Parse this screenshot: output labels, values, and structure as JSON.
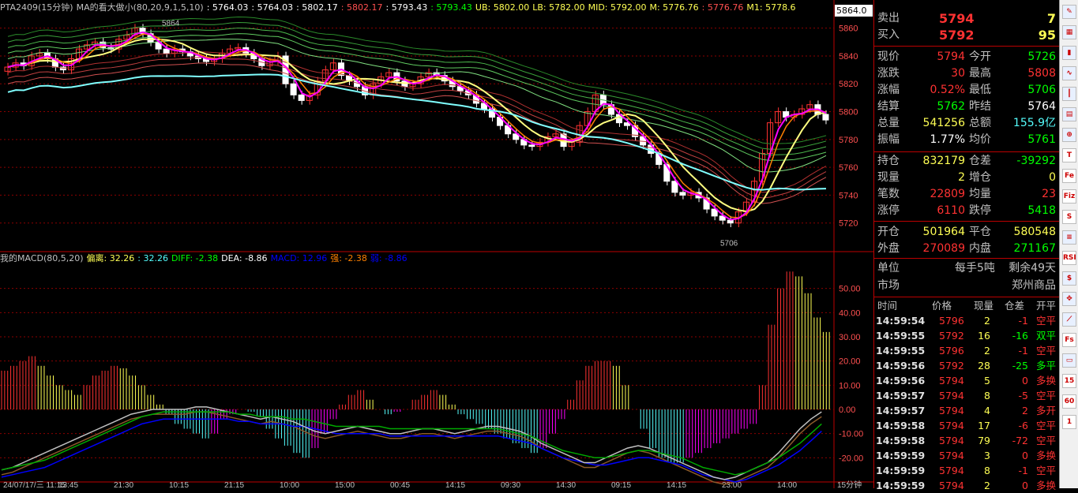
{
  "colors": {
    "up": "#ff3232",
    "down": "#54fcfc",
    "white": "#ffffff",
    "yellow": "#ffff54",
    "green": "#00ff00",
    "magenta": "#ff00ff",
    "orange": "#ff8000",
    "grid": "#8b0000"
  },
  "header": {
    "main": [
      {
        "text": "PTA2409(15分钟)",
        "color": "#c0c0c0"
      },
      {
        "text": "MA的看大做小(80,20,9,1,5,10)",
        "color": "#c0c0c0"
      },
      {
        "text": ": 5764.03",
        "color": "#ffffff"
      },
      {
        "text": ": 5764.03",
        "color": "#ffffff"
      },
      {
        "text": ": 5802.17",
        "color": "#ffffff"
      },
      {
        "text": ": 5802.17",
        "color": "#ff5050"
      },
      {
        "text": ": 5793.43",
        "color": "#ffffff"
      },
      {
        "text": ": 5793.43",
        "color": "#00ff00"
      },
      {
        "text": "UB: 5802.00",
        "color": "#ffff54"
      },
      {
        "text": "LB: 5782.00",
        "color": "#ffff54"
      },
      {
        "text": "MID: 5792.00",
        "color": "#ffff54"
      },
      {
        "text": "M: 5776.76",
        "color": "#ffff54"
      },
      {
        "text": ": 5776.76",
        "color": "#ff5050"
      },
      {
        "text": "M1: 5778.6",
        "color": "#ffff54"
      }
    ],
    "macd": [
      {
        "text": "我的MACD(80,5,20)",
        "color": "#c0c0c0"
      },
      {
        "text": "偏离: 32.26",
        "color": "#ffff54"
      },
      {
        "text": ": 32.26",
        "color": "#54fcfc"
      },
      {
        "text": "DIFF: -2.38",
        "color": "#00ff00"
      },
      {
        "text": "DEA: -8.86",
        "color": "#ffffff"
      },
      {
        "text": "MACD: 12.96",
        "color": "#0000ff"
      },
      {
        "text": "强: -2.38",
        "color": "#ff8000"
      },
      {
        "text": "弱: -8.86",
        "color": "#0000ff"
      }
    ]
  },
  "price_axis": {
    "labels": [
      "5860",
      "5840",
      "5820",
      "5800",
      "5780",
      "5760",
      "5740",
      "5720"
    ],
    "current": "5864.0"
  },
  "macd_axis": {
    "labels": [
      "50.00",
      "40.00",
      "30.00",
      "20.00",
      "10.00",
      "0.00",
      "-10.00",
      "-20.00"
    ]
  },
  "chart_labels": {
    "high_mark": "5864",
    "low_mark": "5706"
  },
  "time_axis": {
    "labels": [
      "24/07/17/三 11:15",
      "13:45",
      "21:30",
      "10:15",
      "21:15",
      "10:00",
      "15:00",
      "00:45",
      "14:15",
      "09:30",
      "14:30",
      "09:15",
      "14:15",
      "23:00",
      "14:00"
    ],
    "period": "15分钟"
  },
  "quote": {
    "ask": {
      "label": "卖出",
      "price": "5794",
      "vol": "7"
    },
    "bid": {
      "label": "买入",
      "price": "5792",
      "vol": "95"
    },
    "rows": [
      {
        "l1": "现价",
        "v1": "5794",
        "c1": "#ff3232",
        "l2": "今开",
        "v2": "5726",
        "c2": "#00ff00"
      },
      {
        "l1": "涨跌",
        "v1": "30",
        "c1": "#ff3232",
        "l2": "最高",
        "v2": "5808",
        "c2": "#ff3232"
      },
      {
        "l1": "涨幅",
        "v1": "0.52%",
        "c1": "#ff3232",
        "l2": "最低",
        "v2": "5706",
        "c2": "#00ff00"
      },
      {
        "l1": "结算",
        "v1": "5762",
        "c1": "#00ff00",
        "l2": "昨结",
        "v2": "5764",
        "c2": "#ffffff"
      },
      {
        "l1": "总量",
        "v1": "541256",
        "c1": "#ffff54",
        "l2": "总额",
        "v2": "155.9亿",
        "c2": "#54fcfc"
      },
      {
        "l1": "振幅",
        "v1": "1.77%",
        "c1": "#ffffff",
        "l2": "均价",
        "v2": "5761",
        "c2": "#00ff00"
      }
    ],
    "rows2": [
      {
        "l1": "持仓",
        "v1": "832179",
        "c1": "#ffff54",
        "l2": "仓差",
        "v2": "-39292",
        "c2": "#00ff00"
      },
      {
        "l1": "现量",
        "v1": "2",
        "c1": "#ffff54",
        "l2": "增仓",
        "v2": "0",
        "c2": "#ffff54"
      },
      {
        "l1": "笔数",
        "v1": "22809",
        "c1": "#ff3232",
        "l2": "均量",
        "v2": "23",
        "c2": "#ff3232"
      },
      {
        "l1": "涨停",
        "v1": "6110",
        "c1": "#ff3232",
        "l2": "跌停",
        "v2": "5418",
        "c2": "#00ff00"
      }
    ],
    "rows3": [
      {
        "l1": "开仓",
        "v1": "501964",
        "c1": "#ffff54",
        "l2": "平仓",
        "v2": "580548",
        "c2": "#ffff54"
      },
      {
        "l1": "外盘",
        "v1": "270089",
        "c1": "#ff3232",
        "l2": "内盘",
        "v2": "271167",
        "c2": "#00ff00"
      }
    ],
    "unit": {
      "label": "单位",
      "value": "每手5吨",
      "extra": "剩余49天"
    },
    "market": {
      "label": "市场",
      "value": "郑州商品"
    }
  },
  "ticks": {
    "headers": [
      "时间",
      "价格",
      "现量",
      "仓差",
      "开平"
    ],
    "rows": [
      {
        "t": "14:59:54",
        "p": "5796",
        "v": "2",
        "d": "-1",
        "k": "空平",
        "pc": "#ff3232",
        "dc": "#ff3232",
        "kc": "#ff3232"
      },
      {
        "t": "14:59:55",
        "p": "5792",
        "v": "16",
        "d": "-16",
        "k": "双平",
        "pc": "#ff3232",
        "dc": "#00ff00",
        "kc": "#00ff00"
      },
      {
        "t": "14:59:55",
        "p": "5796",
        "v": "2",
        "d": "-1",
        "k": "空平",
        "pc": "#ff3232",
        "dc": "#ff3232",
        "kc": "#ff3232"
      },
      {
        "t": "14:59:56",
        "p": "5792",
        "v": "28",
        "d": "-25",
        "k": "多平",
        "pc": "#ff3232",
        "dc": "#00ff00",
        "kc": "#00ff00"
      },
      {
        "t": "14:59:56",
        "p": "5794",
        "v": "5",
        "d": "0",
        "k": "多换",
        "pc": "#ff3232",
        "dc": "#ff3232",
        "kc": "#ff3232"
      },
      {
        "t": "14:59:57",
        "p": "5794",
        "v": "8",
        "d": "-5",
        "k": "空平",
        "pc": "#ff3232",
        "dc": "#ff3232",
        "kc": "#ff3232"
      },
      {
        "t": "14:59:57",
        "p": "5794",
        "v": "4",
        "d": "2",
        "k": "多开",
        "pc": "#ff3232",
        "dc": "#ff3232",
        "kc": "#ff3232"
      },
      {
        "t": "14:59:58",
        "p": "5794",
        "v": "17",
        "d": "-6",
        "k": "空平",
        "pc": "#ff3232",
        "dc": "#ff3232",
        "kc": "#ff3232"
      },
      {
        "t": "14:59:58",
        "p": "5794",
        "v": "79",
        "d": "-72",
        "k": "空平",
        "pc": "#ff3232",
        "dc": "#ff3232",
        "kc": "#ff3232"
      },
      {
        "t": "14:59:59",
        "p": "5794",
        "v": "3",
        "d": "0",
        "k": "多换",
        "pc": "#ff3232",
        "dc": "#ff3232",
        "kc": "#ff3232"
      },
      {
        "t": "14:59:59",
        "p": "5794",
        "v": "8",
        "d": "-1",
        "k": "空平",
        "pc": "#ff3232",
        "dc": "#ff3232",
        "kc": "#ff3232"
      },
      {
        "t": "14:59:59",
        "p": "5794",
        "v": "2",
        "d": "0",
        "k": "多换",
        "pc": "#ff3232",
        "dc": "#ff3232",
        "kc": "#ff3232"
      }
    ]
  },
  "toolbar": {
    "buttons": [
      "pen-icon",
      "chart-icon",
      "bar-icon",
      "line-icon",
      "candle-icon",
      "grid-icon",
      "zoom-icon",
      "T",
      "Fe",
      "Fiz",
      "S",
      "list-icon",
      "RSI",
      "dollar-icon",
      "move-icon",
      "ruler-icon",
      "Fs",
      "doc-icon",
      "15",
      "60",
      "1"
    ]
  },
  "chart_data": [
    {
      "type": "line",
      "title": "PTA2409(15分钟)",
      "ylim": [
        5700,
        5870
      ],
      "series": [
        {
          "name": "close",
          "values": [
            5832,
            5835,
            5833,
            5840,
            5842,
            5838,
            5832,
            5830,
            5838,
            5845,
            5848,
            5850,
            5846,
            5845,
            5852,
            5855,
            5860,
            5856,
            5850,
            5845,
            5842,
            5845,
            5843,
            5840,
            5838,
            5836,
            5838,
            5842,
            5845,
            5846,
            5842,
            5838,
            5833,
            5836,
            5840,
            5820,
            5812,
            5808,
            5812,
            5822,
            5830,
            5835,
            5826,
            5822,
            5818,
            5812,
            5820,
            5825,
            5828,
            5822,
            5818,
            5820,
            5825,
            5828,
            5826,
            5822,
            5818,
            5815,
            5812,
            5806,
            5802,
            5796,
            5790,
            5784,
            5780,
            5776,
            5775,
            5778,
            5782,
            5784,
            5775,
            5778,
            5790,
            5800,
            5812,
            5805,
            5798,
            5792,
            5790,
            5782,
            5776,
            5770,
            5762,
            5750,
            5742,
            5740,
            5742,
            5738,
            5730,
            5725,
            5722,
            5720,
            5728,
            5735,
            5750,
            5770,
            5792,
            5800,
            5796,
            5798,
            5802,
            5805,
            5798,
            5794
          ]
        }
      ]
    },
    {
      "type": "bar",
      "title": "我的MACD(80,5,20)",
      "ylim": [
        -30,
        60
      ],
      "series": [
        {
          "name": "MACD",
          "values": [
            16,
            18,
            20,
            22,
            18,
            14,
            10,
            8,
            6,
            10,
            14,
            16,
            18,
            17,
            14,
            10,
            6,
            2,
            -2,
            -6,
            -8,
            -10,
            -12,
            -10,
            -4,
            -2,
            0,
            -1,
            -3,
            -8,
            -12,
            -15,
            -18,
            -20,
            -16,
            -10,
            -4,
            2,
            6,
            8,
            4,
            0,
            -2,
            -1,
            0,
            4,
            6,
            8,
            6,
            2,
            -2,
            -4,
            -6,
            -8,
            -10,
            -12,
            -14,
            -16,
            -18,
            -16,
            -10,
            -4,
            4,
            12,
            18,
            20,
            20,
            18,
            10,
            0,
            -8,
            -16,
            -20,
            -22,
            -22,
            -20,
            -18,
            -16,
            -14,
            -12,
            -10,
            -8,
            -6,
            10,
            35,
            50,
            57,
            55,
            48,
            38,
            32
          ]
        },
        {
          "name": "DIFF",
          "values": [
            -27,
            -26,
            -24,
            -22,
            -20,
            -18,
            -16,
            -14,
            -12,
            -10,
            -8,
            -6,
            -4,
            -3,
            -2,
            -2,
            -2,
            -2,
            -1,
            -1,
            -2,
            -3,
            -4,
            -5,
            -6,
            -5,
            -6,
            -7,
            -9,
            -11,
            -12,
            -11,
            -10,
            -9,
            -10,
            -11,
            -12,
            -12,
            -11,
            -10,
            -10,
            -11,
            -12,
            -11,
            -10,
            -9,
            -9,
            -10,
            -11,
            -13,
            -16,
            -18,
            -20,
            -22,
            -24,
            -24,
            -22,
            -20,
            -18,
            -17,
            -18,
            -20,
            -22,
            -24,
            -26,
            -28,
            -30,
            -31,
            -30,
            -28,
            -26,
            -24,
            -20,
            -15,
            -10,
            -6,
            -3
          ]
        },
        {
          "name": "DEA",
          "values": [
            -28,
            -27,
            -26,
            -25,
            -24,
            -22,
            -20,
            -18,
            -16,
            -14,
            -12,
            -10,
            -8,
            -6,
            -5,
            -4,
            -4,
            -4,
            -4,
            -4,
            -4,
            -4,
            -5,
            -5,
            -6,
            -6,
            -6,
            -7,
            -7,
            -8,
            -9,
            -10,
            -10,
            -10,
            -10,
            -10,
            -11,
            -11,
            -11,
            -11,
            -11,
            -11,
            -11,
            -11,
            -11,
            -11,
            -11,
            -12,
            -13,
            -14,
            -16,
            -18,
            -20,
            -21,
            -22,
            -23,
            -23,
            -22,
            -21,
            -20,
            -20,
            -21,
            -22,
            -23,
            -25,
            -27,
            -28,
            -29,
            -30,
            -29,
            -27,
            -25,
            -23,
            -20,
            -17,
            -13,
            -9
          ]
        }
      ]
    }
  ]
}
